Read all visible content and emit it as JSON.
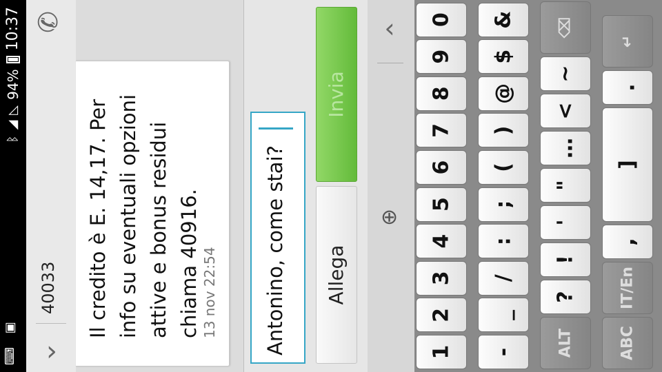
{
  "status_bar": {
    "time": "10:37",
    "battery": "94%",
    "bluetooth_icon": "bluetooth-icon",
    "wifi_icon": "wifi-icon",
    "signal_icon": "signal-icon"
  },
  "header": {
    "back_icon": "chevron-down-icon",
    "contact": "40033",
    "call_icon": "phone-icon"
  },
  "message": {
    "text": "Il credito è E. 14,17. Per info su eventuali opzioni attive e bonus residui chiama 40916.",
    "timestamp": "13 nov 22:54"
  },
  "compose": {
    "input_value": "Antonino, come stai?",
    "attach_label": "Allega",
    "send_label": "Invia"
  },
  "toolbar": {
    "language_icon": "globe-icon",
    "collapse_icon": "chevron-right-icon"
  },
  "keyboard": {
    "row1": [
      "1",
      "2",
      "3",
      "4",
      "5",
      "6",
      "7",
      "8",
      "9",
      "0"
    ],
    "row2": [
      "-",
      "_",
      "/",
      ":",
      ";",
      "(",
      ")",
      "@",
      "$",
      "&"
    ],
    "row3": [
      "ALT",
      "?",
      "!",
      "'",
      "\"",
      "…",
      "<",
      "~",
      "⌫"
    ],
    "row4": [
      "ABC",
      "IT/En",
      ",",
      "]",
      ".",
      "↵"
    ]
  },
  "colors": {
    "accent": "#35a6c6",
    "send_green": "#63bb3a"
  }
}
